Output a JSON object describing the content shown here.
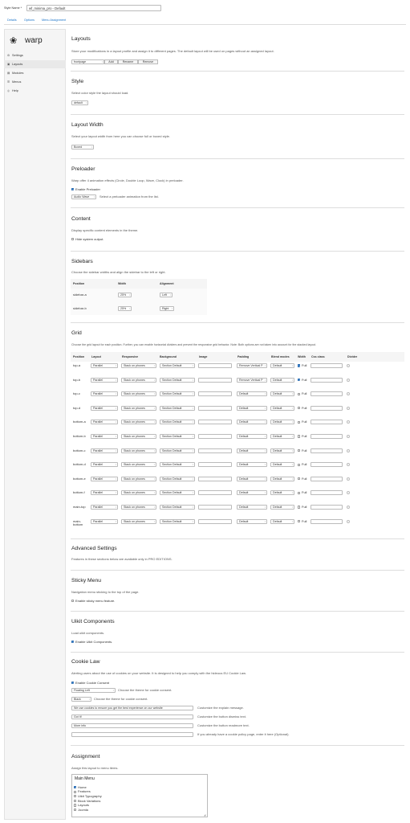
{
  "header": {
    "style_name_label": "Style Name *",
    "style_name_value": "wf_minima_pro - Default"
  },
  "tabs": [
    "Details",
    "Options",
    "Menu Assignment"
  ],
  "sidebar": {
    "logo": "warp",
    "items": [
      {
        "label": "Settings",
        "icon": "gear-icon",
        "glyph": "⚙"
      },
      {
        "label": "Layouts",
        "icon": "layout-icon",
        "glyph": "▣"
      },
      {
        "label": "Modules",
        "icon": "modules-icon",
        "glyph": "▤"
      },
      {
        "label": "Menus",
        "icon": "menu-icon",
        "glyph": "☰"
      },
      {
        "label": "Help",
        "icon": "help-icon",
        "glyph": "◎"
      }
    ]
  },
  "layouts": {
    "title": "Layouts",
    "desc": "Store your modifications in a layout profile and assign it to different pages. The default layout will be used on pages without an assigned layout.",
    "profile": "frontpage",
    "add": "Add",
    "rename": "Rename",
    "remove": "Remove"
  },
  "style": {
    "title": "Style",
    "desc": "Select color style the layout should load.",
    "value": "default"
  },
  "layout_width": {
    "title": "Layout Width",
    "desc": "Select your layout width from here you can choose full or boxed style.",
    "value": "Boxed"
  },
  "preloader": {
    "title": "Preloader",
    "desc": "Warp offer 4 animation effects (Circle, Double Loop, Wave, Clock) in preloader.",
    "enable_label": "Enable Preloader",
    "animation": "Audio Wave",
    "animation_help": "Select a preloader animation from the list."
  },
  "content": {
    "title": "Content",
    "desc": "Display specific content elements in the theme.",
    "hide_label": "Hide system output."
  },
  "sidebars": {
    "title": "Sidebars",
    "desc": "Choose the sidebar widths and align the sidebar to the left or right.",
    "headers": [
      "Position",
      "Width",
      "Alignment"
    ],
    "rows": [
      {
        "position": "sidebar-a",
        "width": "25%",
        "alignment": "Left"
      },
      {
        "position": "sidebar-b",
        "width": "25%",
        "alignment": "Right"
      }
    ]
  },
  "grid": {
    "title": "Grid",
    "desc": "Choose the grid layout for each position. Further, you can enable horizontal dividers and prevent the responsive grid behavior. Note: Both options are not taken into account for the stacked layout.",
    "headers": [
      "Position",
      "Layout",
      "Responsive",
      "Background",
      "Image",
      "Padding",
      "Blend modes",
      "Width",
      "Css class",
      "Divider"
    ],
    "full_label": "Full",
    "rows": [
      {
        "position": "top-a",
        "layout": "Parallel",
        "responsive": "Stack on phones",
        "background": "Section Default",
        "padding": "Remove Vertical P",
        "blend": "Default",
        "full": true
      },
      {
        "position": "top-b",
        "layout": "Parallel",
        "responsive": "Stack on phones",
        "background": "Section Default",
        "padding": "Remove Vertical P",
        "blend": "Default",
        "full": true
      },
      {
        "position": "top-c",
        "layout": "Parallel",
        "responsive": "Stack on phones",
        "background": "Section Default",
        "padding": "Default",
        "blend": "Default",
        "full": false
      },
      {
        "position": "top-d",
        "layout": "Parallel",
        "responsive": "Stack on phones",
        "background": "Section Default",
        "padding": "Default",
        "blend": "Default",
        "full": false
      },
      {
        "position": "bottom-a",
        "layout": "Parallel",
        "responsive": "Stack on phones",
        "background": "Section Default",
        "padding": "Default",
        "blend": "Default",
        "full": false
      },
      {
        "position": "bottom-b",
        "layout": "Parallel",
        "responsive": "Stack on phones",
        "background": "Section Default",
        "padding": "Default",
        "blend": "Default",
        "full": false
      },
      {
        "position": "bottom-c",
        "layout": "Parallel",
        "responsive": "Stack on phones",
        "background": "Section Default",
        "padding": "Default",
        "blend": "Default",
        "full": false
      },
      {
        "position": "bottom-d",
        "layout": "Parallel",
        "responsive": "Stack on phones",
        "background": "Section Default",
        "padding": "Default",
        "blend": "Default",
        "full": false
      },
      {
        "position": "bottom-e",
        "layout": "Parallel",
        "responsive": "Stack on phones",
        "background": "Section Default",
        "padding": "Default",
        "blend": "Default",
        "full": false
      },
      {
        "position": "bottom-f",
        "layout": "Parallel",
        "responsive": "Stack on phones",
        "background": "Section Default",
        "padding": "Default",
        "blend": "Default",
        "full": false
      },
      {
        "position": "main-top",
        "layout": "Parallel",
        "responsive": "Stack on phones",
        "background": "Section Default",
        "padding": "Default",
        "blend": "Default",
        "full": false
      },
      {
        "position": "main-bottom",
        "layout": "Parallel",
        "responsive": "Stack on phones",
        "background": "Section Default",
        "padding": "Default",
        "blend": "Default",
        "full": false
      }
    ]
  },
  "advanced": {
    "title": "Advanced Settings",
    "desc": "Features in these sections below are available only in PRO EDITIONS."
  },
  "sticky": {
    "title": "Sticky Menu",
    "desc": "Navigation menu sticking to the top of the page.",
    "enable_label": "Enable sticky menu feature."
  },
  "uikit": {
    "title": "Uikit Components",
    "desc": "Load uikit components.",
    "enable_label": "Enable Uikit Components."
  },
  "cookie": {
    "title": "Cookie Law",
    "desc": "Alerting users about the use of cookies on your website. It is designed to help you comply with the hideous EU Cookie Law.",
    "enable_label": "Enable Cookie Consent",
    "position": "Floating Left",
    "position_help": "Choose the theme for cookie consent.",
    "theme": "Black",
    "theme_help": "Choose the theme for cookie consent.",
    "message": "We use cookies to ensure you get the best experience on our website",
    "message_help": "Customize the explain message.",
    "dismiss": "Got It!",
    "dismiss_help": "Customize the button dismiss text.",
    "more": "More info",
    "more_help": "Customize the button readmore text.",
    "policy": "",
    "policy_help": "If you already have a cookie policy page, enter it here (Optional)."
  },
  "assignment": {
    "title": "Assignment",
    "desc": "Assign this layout to menu items.",
    "menu_title": "Main Menu",
    "items": [
      {
        "label": "Home",
        "checked": true
      },
      {
        "label": "Features",
        "checked": false
      },
      {
        "label": "Uikit Typography",
        "checked": false
      },
      {
        "label": "Block Variations",
        "checked": false
      },
      {
        "label": "Layouts",
        "checked": false
      },
      {
        "label": "Joomla",
        "checked": false
      }
    ]
  },
  "colors": {
    "accent": "#3a87d8",
    "link": "#1a73c8",
    "sidebar_bg": "#f5f5f5"
  }
}
